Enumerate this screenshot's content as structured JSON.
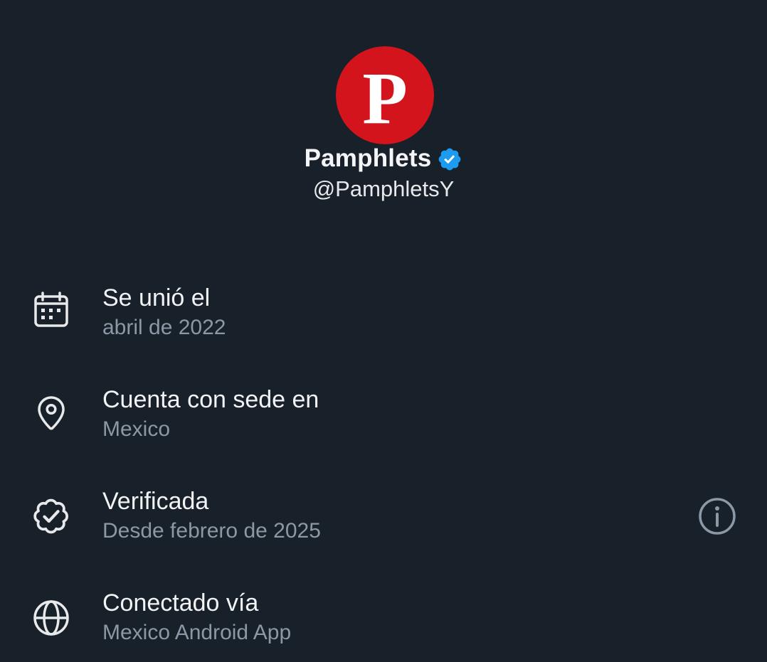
{
  "profile": {
    "avatar_letter": "P",
    "display_name": "Pamphlets",
    "handle": "@PamphletsY",
    "verified": true
  },
  "about": {
    "items": [
      {
        "icon": "calendar-icon",
        "title": "Se unió el",
        "subtitle": "abril de 2022"
      },
      {
        "icon": "location-pin-icon",
        "title": "Cuenta con sede en",
        "subtitle": "Mexico"
      },
      {
        "icon": "verified-badge-icon",
        "title": "Verificada",
        "subtitle": "Desde febrero de 2025",
        "has_info": true
      },
      {
        "icon": "globe-icon",
        "title": "Conectado vía",
        "subtitle": "Mexico Android App"
      }
    ]
  },
  "colors": {
    "background": "#18202a",
    "avatar_red": "#d4141c",
    "verified_blue": "#1d9bf0",
    "secondary_text": "#8b98a5"
  }
}
